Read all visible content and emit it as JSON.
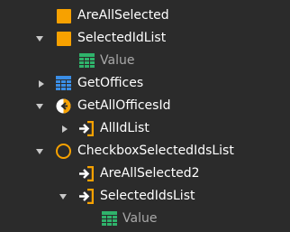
{
  "colors": {
    "background": "#2b2b2b",
    "text": "#ffffff",
    "dim_text": "#a9a9a9",
    "orange": "#f7a100",
    "blue": "#3a8ee6",
    "green": "#2fb36b",
    "arrow": "#c8c8c8"
  },
  "tree": {
    "items": [
      {
        "label": "AreAllSelected",
        "icon": "orange-square-icon",
        "expander": "none"
      },
      {
        "label": "SelectedIdList",
        "icon": "orange-square-icon",
        "expander": "expanded"
      },
      {
        "label": "Value",
        "icon": "green-grid-icon",
        "expander": "none",
        "dim": true
      },
      {
        "label": "GetOffices",
        "icon": "blue-grid-icon",
        "expander": "collapsed"
      },
      {
        "label": "GetAllOfficesId",
        "icon": "output-circle-icon",
        "expander": "expanded"
      },
      {
        "label": "AllIdList",
        "icon": "input-arrow-icon",
        "expander": "collapsed"
      },
      {
        "label": "CheckboxSelectedIdsList",
        "icon": "orange-ring-icon",
        "expander": "expanded"
      },
      {
        "label": "AreAllSelected2",
        "icon": "input-arrow-icon",
        "expander": "none"
      },
      {
        "label": "SelectedIdsList",
        "icon": "input-arrow-icon",
        "expander": "expanded"
      },
      {
        "label": "Value",
        "icon": "green-grid-icon",
        "expander": "none",
        "dim": true
      }
    ]
  }
}
